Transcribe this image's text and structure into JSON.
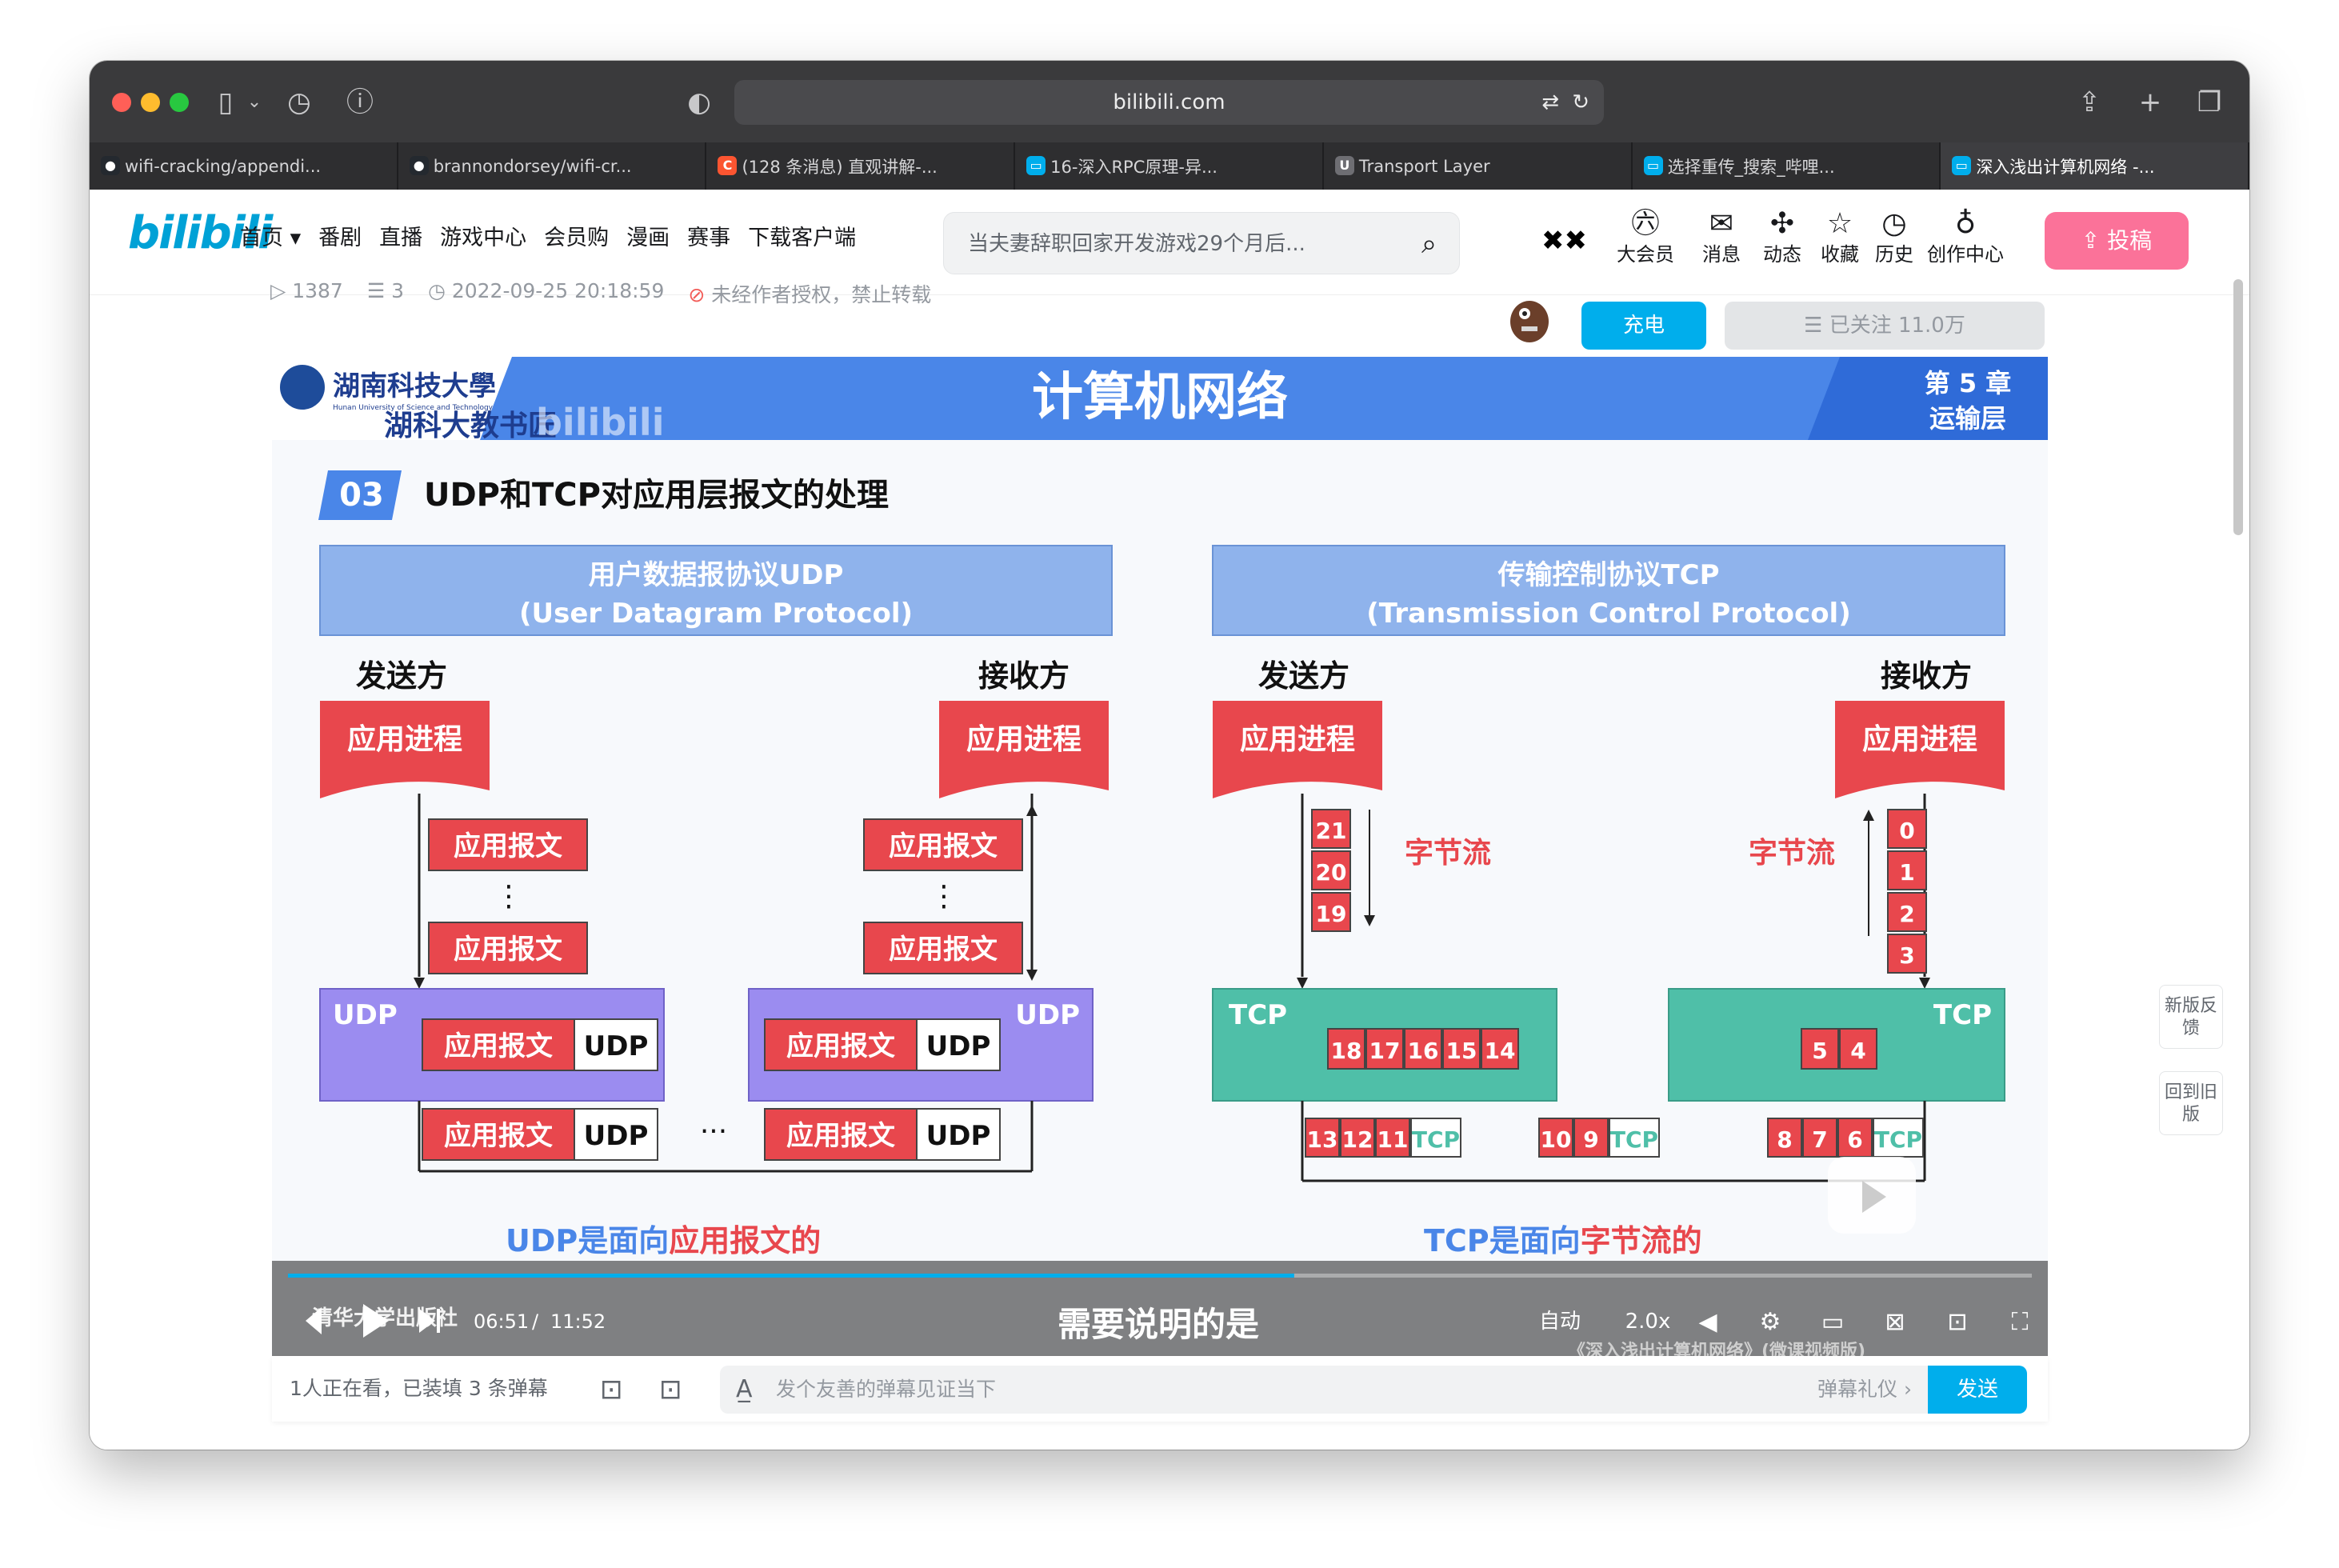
{
  "browser": {
    "url": "bilibili.com",
    "tabs": [
      {
        "label": "wifi-cracking/appendi...",
        "icon": "github-icon"
      },
      {
        "label": "brannondorsey/wifi-cr...",
        "icon": "github-icon"
      },
      {
        "label": "(128 条消息) 直观讲解-...",
        "icon": "csdn-icon"
      },
      {
        "label": "16-深入RPC原理-异...",
        "icon": "bilibili-tv-icon"
      },
      {
        "label": "Transport Layer",
        "icon": "u-icon"
      },
      {
        "label": "选择重传_搜索_哔哩...",
        "icon": "bilibili-tv-icon"
      },
      {
        "label": "深入浅出计算机网络 -...",
        "icon": "bilibili-tv-icon"
      }
    ]
  },
  "nav": {
    "logo": "bilibili",
    "items": [
      "首页 ▾",
      "番剧",
      "直播",
      "游戏中心",
      "会员购",
      "漫画",
      "赛事",
      "下载客户端"
    ],
    "search_placeholder": "当夫妻辞职回家开发游戏29个月后...",
    "right": [
      {
        "label": "大会员",
        "icon": "vip-icon",
        "glyph": "㊅"
      },
      {
        "label": "消息",
        "icon": "message-icon",
        "glyph": "✉"
      },
      {
        "label": "动态",
        "icon": "dynamic-icon",
        "glyph": "✣"
      },
      {
        "label": "收藏",
        "icon": "star-icon",
        "glyph": "☆"
      },
      {
        "label": "历史",
        "icon": "clock-icon",
        "glyph": "◷"
      },
      {
        "label": "创作中心",
        "icon": "bulb-icon",
        "glyph": "♁"
      }
    ],
    "upload": "投稿"
  },
  "meta": {
    "plays": "1387",
    "danmaku": "3",
    "date": "2022-09-25 20:18:59",
    "notice": "未经作者授权，禁止转载"
  },
  "author_actions": {
    "charge": "充电",
    "follow": "☰ 已关注 11.0万"
  },
  "slide": {
    "school": "湖南科技大學",
    "school_en": "Hunan University of Science and Technology",
    "school_sub": "湖科大教书匠",
    "course": "计算机网络",
    "chapter": "第 5 章",
    "chapter_name": "运输层",
    "section_no": "03",
    "section_title": "UDP和TCP对应用层报文的处理",
    "udp_title": "用户数据报协议UDP",
    "udp_title_en": "(User Datagram Protocol)",
    "tcp_title": "传输控制协议TCP",
    "tcp_title_en": "(Transmission Control Protocol)",
    "sender": "发送方",
    "receiver": "接收方",
    "app_process": "应用进程",
    "app_message": "应用报文",
    "udp": "UDP",
    "tcp": "TCP",
    "byte_stream": "字节流",
    "sender_bytes": [
      "21",
      "20",
      "19"
    ],
    "receiver_bytes": [
      "0",
      "1",
      "2",
      "3"
    ],
    "tcp_send_buffer": [
      "18",
      "17",
      "16",
      "15",
      "14"
    ],
    "tcp_recv_buffer": [
      "5",
      "4"
    ],
    "segments": [
      [
        "13",
        "12",
        "11"
      ],
      [
        "10",
        "9"
      ],
      [
        "8",
        "7",
        "6"
      ]
    ],
    "udp_conclusion_a": "UDP是面向",
    "udp_conclusion_b": "应用报文的",
    "tcp_conclusion_a": "TCP是面向",
    "tcp_conclusion_b": "字节流的",
    "publisher": "清华大学出版社",
    "book": "《深入浅出计算机网络》(微课视频版)"
  },
  "player": {
    "time_current": "06:51",
    "time_total": "11:52",
    "progress": 0.577,
    "subtitle": "需要说明的是",
    "quality": "自动",
    "speed": "2.0x"
  },
  "danmaku_bar": {
    "status": "1人正在看，已装填 3 条弹幕",
    "placeholder": "发个友善的弹幕见证当下",
    "etiquette": "弹幕礼仪 ›",
    "send": "发送"
  },
  "side": {
    "feedback": "新版反馈",
    "old": "回到旧版"
  },
  "colors": {
    "accent": "#00aeec",
    "pink": "#fb7299",
    "slide_red": "#e8474d",
    "udp_purple": "#9b8cf0",
    "tcp_teal": "#4fbfa8",
    "slide_blue": "#4a86e8"
  }
}
